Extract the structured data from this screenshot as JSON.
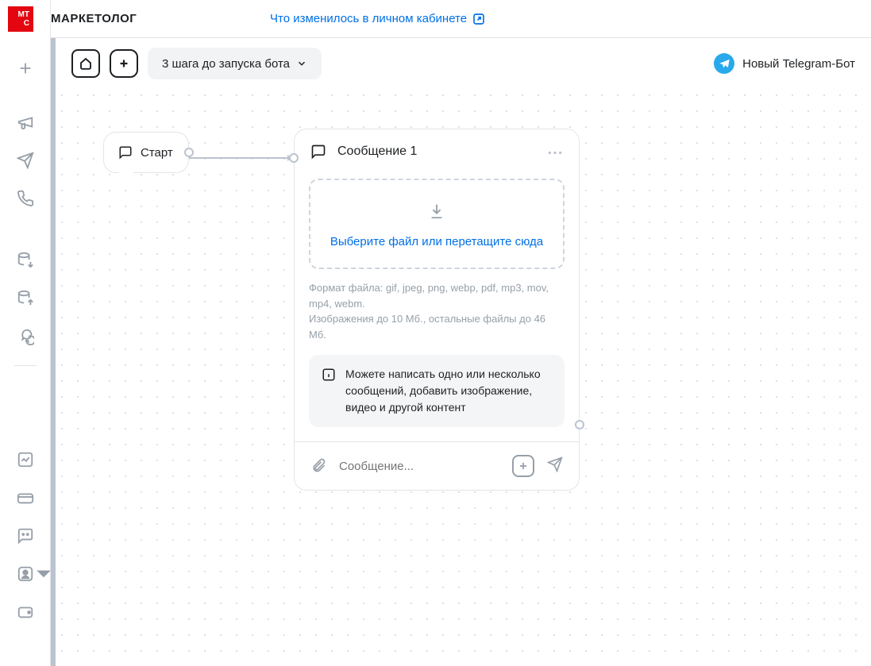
{
  "brand": "МАРКЕТОЛОГ",
  "logo_text_top": "МТ",
  "logo_text_bottom": "С",
  "header_link": "Что изменилось в личном кабинете",
  "toolbar": {
    "steps_label": "3 шага до запуска бота",
    "bot_name": "Новый Telegram-Бот"
  },
  "start_node": {
    "label": "Старт"
  },
  "message_node": {
    "title": "Сообщение 1",
    "dropzone_text": "Выберите файл или перетащите сюда",
    "format_hint_1": "Формат файла: gif, jpeg, png, webp, pdf, mp3, mov, mp4, webm.",
    "format_hint_2": "Изображения до 10 Мб., остальные файлы до 46 Мб.",
    "info_text": "Можете написать одно или несколько сообщений, добавить изображение, видео и другой контент",
    "input_placeholder": "Сообщение..."
  }
}
